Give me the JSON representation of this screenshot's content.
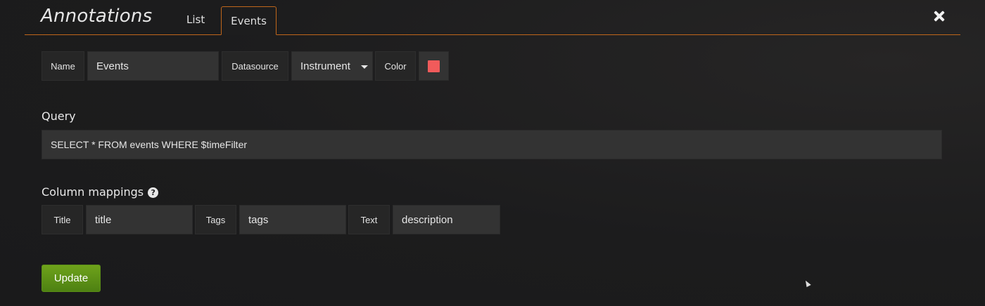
{
  "header": {
    "title": "Annotations",
    "tabs": [
      {
        "label": "List",
        "active": false
      },
      {
        "label": "Events",
        "active": true
      }
    ],
    "accent_color": "#c0661b"
  },
  "settings": {
    "name_label": "Name",
    "name_value": "Events",
    "datasource_label": "Datasource",
    "datasource_value": "Instrument",
    "color_label": "Color",
    "color_value": "#f15b5b"
  },
  "query": {
    "label": "Query",
    "value": "SELECT * FROM events WHERE  $timeFilter"
  },
  "column_mappings": {
    "label": "Column mappings",
    "help_icon": "question-circle-icon",
    "title_label": "Title",
    "title_value": "title",
    "tags_label": "Tags",
    "tags_value": "tags",
    "text_label": "Text",
    "text_value": "description"
  },
  "actions": {
    "update_label": "Update",
    "update_color": "#5b8f16"
  }
}
